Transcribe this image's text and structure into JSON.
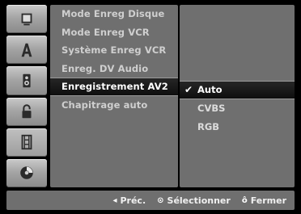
{
  "sidebar": {
    "icons": [
      {
        "name": "disc-screen-icon"
      },
      {
        "name": "language-a-icon"
      },
      {
        "name": "audio-speaker-icon"
      },
      {
        "name": "lock-icon"
      },
      {
        "name": "film-recording-icon"
      },
      {
        "name": "dvd-disc-icon"
      }
    ],
    "active_index": 4
  },
  "menu": {
    "items": [
      {
        "label": "Mode Enreg Disque"
      },
      {
        "label": "Mode Enreg VCR"
      },
      {
        "label": "Système Enreg VCR"
      },
      {
        "label": "Enreg. DV Audio"
      },
      {
        "label": "Enregistrement AV2"
      },
      {
        "label": "Chapitrage auto"
      }
    ],
    "selected_index": 4
  },
  "options": {
    "items": [
      {
        "label": "Auto",
        "checked": true
      },
      {
        "label": "CVBS",
        "checked": false
      },
      {
        "label": "RGB",
        "checked": false
      }
    ],
    "check_glyph": "✔"
  },
  "footer": {
    "prev": {
      "symbol": "◂",
      "label": "Préc."
    },
    "select": {
      "symbol": "⊙",
      "label": "Sélectionner"
    },
    "close": {
      "symbol": "ô",
      "label": "Fermer"
    }
  }
}
